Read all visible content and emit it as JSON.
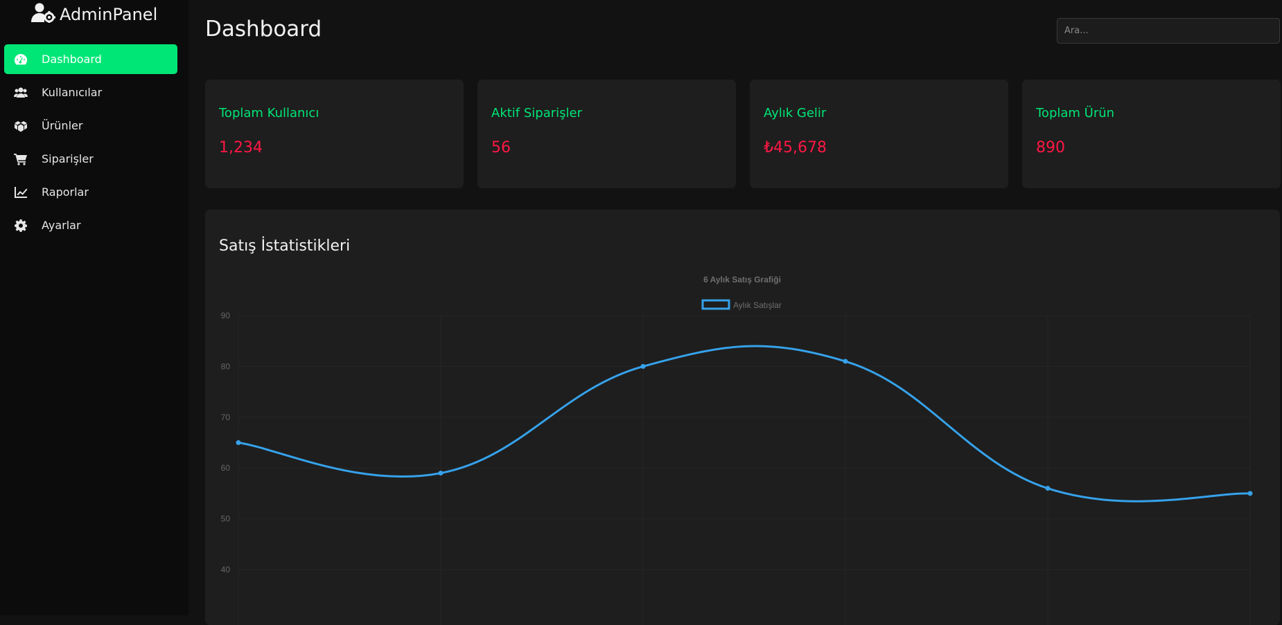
{
  "app": {
    "name": "AdminPanel",
    "logo_icon": "user-gear-icon"
  },
  "sidebar": {
    "items": [
      {
        "label": "Dashboard",
        "icon": "gauge-icon",
        "active": true
      },
      {
        "label": "Kullanıcılar",
        "icon": "users-icon",
        "active": false
      },
      {
        "label": "Ürünler",
        "icon": "boxes-icon",
        "active": false
      },
      {
        "label": "Siparişler",
        "icon": "cart-icon",
        "active": false
      },
      {
        "label": "Raporlar",
        "icon": "chart-line-icon",
        "active": false
      },
      {
        "label": "Ayarlar",
        "icon": "gear-icon",
        "active": false
      }
    ]
  },
  "header": {
    "title": "Dashboard",
    "search_placeholder": "Ara..."
  },
  "stats": [
    {
      "title": "Toplam Kullanıcı",
      "value": "1,234"
    },
    {
      "title": "Aktif Siparişler",
      "value": "56"
    },
    {
      "title": "Aylık Gelir",
      "value": "₺45,678"
    },
    {
      "title": "Toplam Ürün",
      "value": "890"
    }
  ],
  "colors": {
    "accent": "#00e676",
    "value": "#ff1744",
    "line": "#36a2eb"
  },
  "chart_section": {
    "title": "Satış İstatistikleri"
  },
  "chart_data": {
    "type": "line",
    "title": "6 Aylık Satış Grafiği",
    "series": [
      {
        "name": "Aylık Satışlar",
        "values": [
          65,
          59,
          80,
          81,
          56,
          55
        ]
      }
    ],
    "yticks": [
      90,
      80,
      70,
      60,
      50,
      40
    ],
    "ylim": [
      35,
      90
    ],
    "legend": "top",
    "grid": true
  }
}
